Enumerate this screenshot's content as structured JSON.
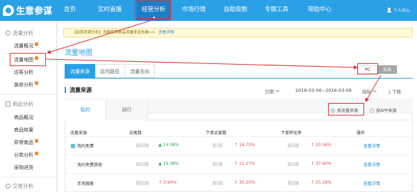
{
  "app": {
    "title": "生意参谋"
  },
  "topnav": {
    "items": [
      {
        "label": "首页"
      },
      {
        "label": "实时直播"
      },
      {
        "label": "经营分析"
      },
      {
        "label": "市场行情"
      },
      {
        "label": "自助取数"
      },
      {
        "label": "专题工具"
      },
      {
        "label": "帮助中心"
      }
    ],
    "user_label": "个人中心"
  },
  "sidebar": {
    "section1": "流量分析",
    "flow_items": [
      "流量概况",
      "流量地图",
      "访客分析",
      "装修分析"
    ],
    "section2": "商品分析",
    "goods_items": [
      "商品概况",
      "商品效果",
      "异常商品",
      "分类分析",
      "采购进货"
    ],
    "section3": "交易分析"
  },
  "notice": {
    "text": "【玩转来源分析】流量转商单品流量来龙去脉>>",
    "link": "查看详情"
  },
  "page_title": "流量地图",
  "tabs": [
    "流量来源",
    "店内路径",
    "流量去向"
  ],
  "device": {
    "pc": "PC",
    "wireless": "无线"
  },
  "panel": {
    "title": "流量来源",
    "date_label": "日期",
    "date_range": "2016-03-06~2016-03-06",
    "indicator": "指标",
    "download": "下载"
  },
  "subtabs": {
    "mine": "我的",
    "peers": "同行"
  },
  "radios": {
    "by_flow": "按流量来源",
    "by_app": "按APP来源"
  },
  "table": {
    "headers": [
      "流量来源",
      "访客数",
      "下单买家数",
      "下单转化率",
      "操作"
    ],
    "rows": [
      {
        "source": "淘内免费",
        "visitors_change": "14.08%",
        "buyers_change": "14.75%",
        "rate_change": "33.56%",
        "action": "查看详情"
      },
      {
        "source": "淘内免费其他",
        "visitors_change": "19.38%",
        "buyers_change": "11.17%",
        "rate_change": "37.90%",
        "action": "查看详情"
      },
      {
        "source": "手淘搜索",
        "visitors_change": "3.94%",
        "buyers_change": "30.20%",
        "rate_change": "25.28%",
        "action": "查看详情"
      }
    ]
  },
  "colors": {
    "brand": "#2aa0e6",
    "highlight": "#e0302f",
    "up_green": "#2da24f",
    "up_red": "#e24a4a"
  }
}
